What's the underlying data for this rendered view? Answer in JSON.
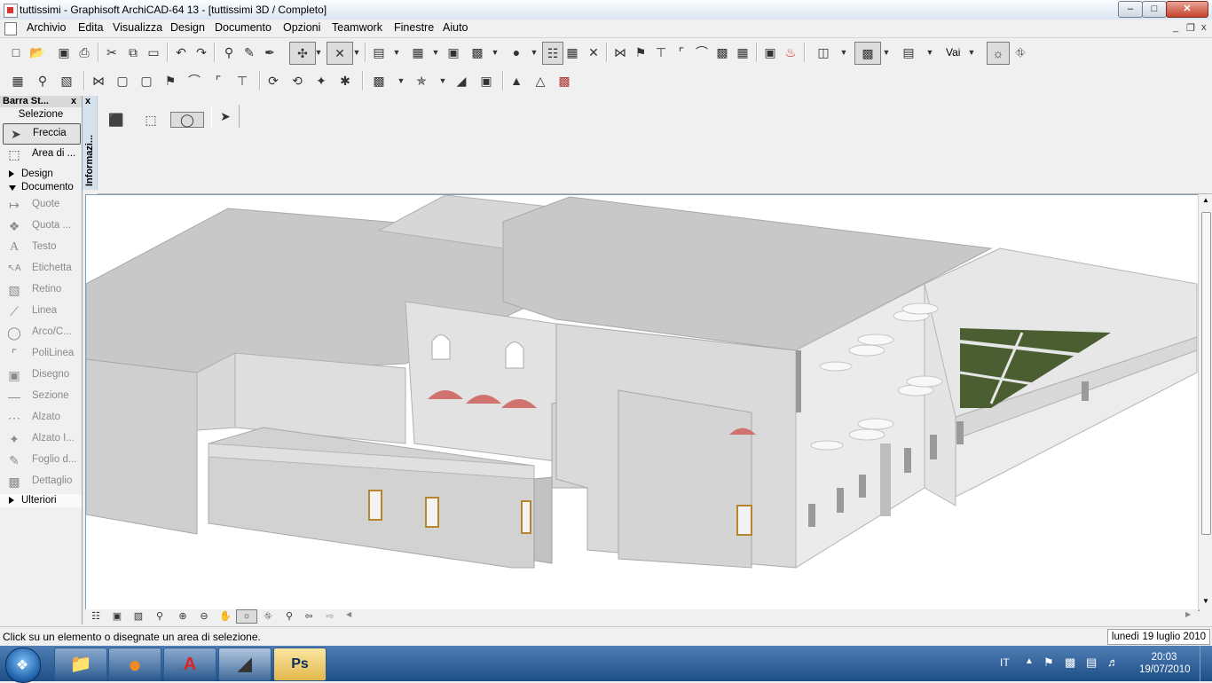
{
  "window": {
    "title": "tuttissimi - Graphisoft ArchiCAD-64 13 - [tuttissimi 3D / Completo]",
    "controls": {
      "minimize": "–",
      "maximize": "□",
      "close": "✕"
    }
  },
  "menu": {
    "items": [
      "Archivio",
      "Edita",
      "Visualizza",
      "Design",
      "Documento",
      "Opzioni",
      "Teamwork",
      "Finestre",
      "Aiuto"
    ],
    "mdi": {
      "minimize": "_",
      "restore": "❐",
      "close": "x"
    }
  },
  "toolbar": {
    "vai_label": "Vai"
  },
  "palette": {
    "title": "Barra St...",
    "close": "x",
    "selezione_label": "Selezione",
    "tools": [
      {
        "label": "Freccia",
        "icon": "arrow-pointer-icon"
      },
      {
        "label": "Area di ...",
        "icon": "marquee-icon"
      }
    ],
    "sections": {
      "design": "Design",
      "documento": "Documento",
      "ulteriori": "Ulteriori"
    },
    "documento_tools": [
      {
        "label": "Quote",
        "icon": "dimension-icon"
      },
      {
        "label": "Quota ...",
        "icon": "level-dimension-icon"
      },
      {
        "label": "Testo",
        "icon": "text-icon"
      },
      {
        "label": "Etichetta",
        "icon": "label-icon"
      },
      {
        "label": "Retino",
        "icon": "fill-icon"
      },
      {
        "label": "Linea",
        "icon": "line-icon"
      },
      {
        "label": "Arco/C...",
        "icon": "arc-icon"
      },
      {
        "label": "PoliLinea",
        "icon": "polyline-icon"
      },
      {
        "label": "Disegno",
        "icon": "drawing-icon"
      },
      {
        "label": "Sezione",
        "icon": "section-icon"
      },
      {
        "label": "Alzato",
        "icon": "elevation-icon"
      },
      {
        "label": "Alzato I...",
        "icon": "interior-elevation-icon"
      },
      {
        "label": "Foglio d...",
        "icon": "worksheet-icon"
      },
      {
        "label": "Dettaglio",
        "icon": "detail-icon"
      }
    ]
  },
  "infobox": {
    "label": "Informazi...",
    "close": "x"
  },
  "status": {
    "message": "Click su un elemento o disegnate un area di selezione.",
    "date": "lunedì 19 luglio 2010"
  },
  "taskbar": {
    "apps": [
      {
        "name": "explorer",
        "glyph": "📁"
      },
      {
        "name": "firefox",
        "glyph": "●"
      },
      {
        "name": "autocad",
        "glyph": "A"
      },
      {
        "name": "archicad",
        "glyph": "◢"
      },
      {
        "name": "photoshop",
        "glyph": "Ps"
      }
    ],
    "language": "IT",
    "time": "20:03",
    "date": "19/07/2010"
  },
  "colors": {
    "taskbar": "#2b63a0",
    "roof": "#cdcdcd",
    "wall": "#e6e6e6",
    "arch": "#d0736f",
    "grass": "#4a5e32"
  }
}
